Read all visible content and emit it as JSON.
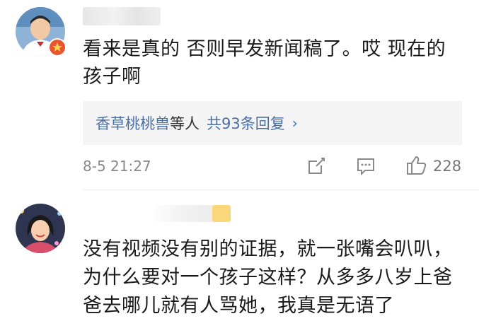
{
  "comments": [
    {
      "text_line1": "看来是真的 否则早发新闻稿了。哎 现在的",
      "text_line2": "孩子啊",
      "replies": {
        "names": "香草桃桃兽",
        "and_others": "等人",
        "total": "共93条回复"
      },
      "timestamp": "8-5 21:27",
      "like_count": "228"
    },
    {
      "text_line1": "没有视频没有别的证据，就一张嘴会叭叭，",
      "text_line2": "为什么要对一个孩子这样？从多多八岁上爸",
      "text_line3": "爸去哪儿就有人骂她，我真是无语了"
    }
  ],
  "icons": {
    "share": "share-icon",
    "comment": "comment-icon",
    "like": "thumbs-up-icon",
    "badge": "verified-badge-icon",
    "chevron": "chevron-right-icon"
  },
  "colors": {
    "link_blue": "#4a6fa3",
    "reply_bg": "#f4f4f4",
    "meta_gray": "#8a8a8a",
    "badge_red": "#e8542f",
    "highlight_yellow": "#f9d77a"
  }
}
